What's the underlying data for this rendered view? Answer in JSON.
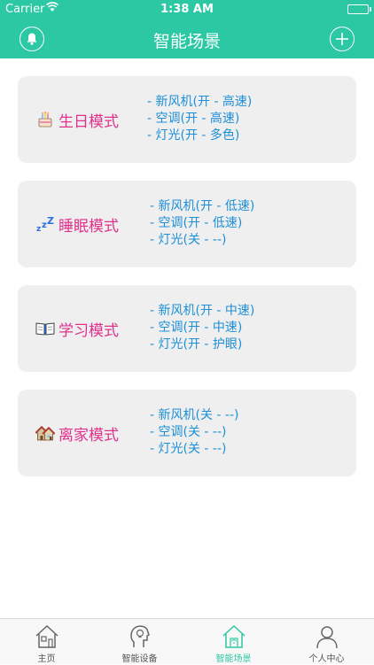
{
  "status": {
    "carrier": "Carrier",
    "time": "1:38 AM"
  },
  "nav": {
    "title": "智能场景"
  },
  "scenes": [
    {
      "name": "生日模式",
      "icon": "birthday-cake-icon",
      "details": [
        "- 新风机(开 - 高速)",
        "- 空调(开 - 高速)",
        "- 灯光(开 - 多色)"
      ]
    },
    {
      "name": "睡眠模式",
      "icon": "sleep-zzz-icon",
      "details": [
        "- 新风机(开 - 低速)",
        "- 空调(开 - 低速)",
        "- 灯光(关 - --)"
      ]
    },
    {
      "name": "学习模式",
      "icon": "open-book-icon",
      "details": [
        "- 新风机(开 - 中速)",
        "- 空调(开 - 中速)",
        "- 灯光(开 - 护眼)"
      ]
    },
    {
      "name": "离家模式",
      "icon": "houses-icon",
      "details": [
        "- 新风机(关 - --)",
        "- 空调(关 - --)",
        "- 灯光(关 - --)"
      ]
    }
  ],
  "tabs": [
    {
      "label": "主页",
      "icon": "home-icon",
      "active": false
    },
    {
      "label": "智能设备",
      "icon": "head-bulb-icon",
      "active": false
    },
    {
      "label": "智能场景",
      "icon": "smart-home-icon",
      "active": true
    },
    {
      "label": "个人中心",
      "icon": "person-icon",
      "active": false
    }
  ],
  "colors": {
    "accent": "#2bc8a3",
    "mode_name": "#e0328c",
    "detail_text": "#1d8fd6",
    "card_bg": "#efefef"
  }
}
